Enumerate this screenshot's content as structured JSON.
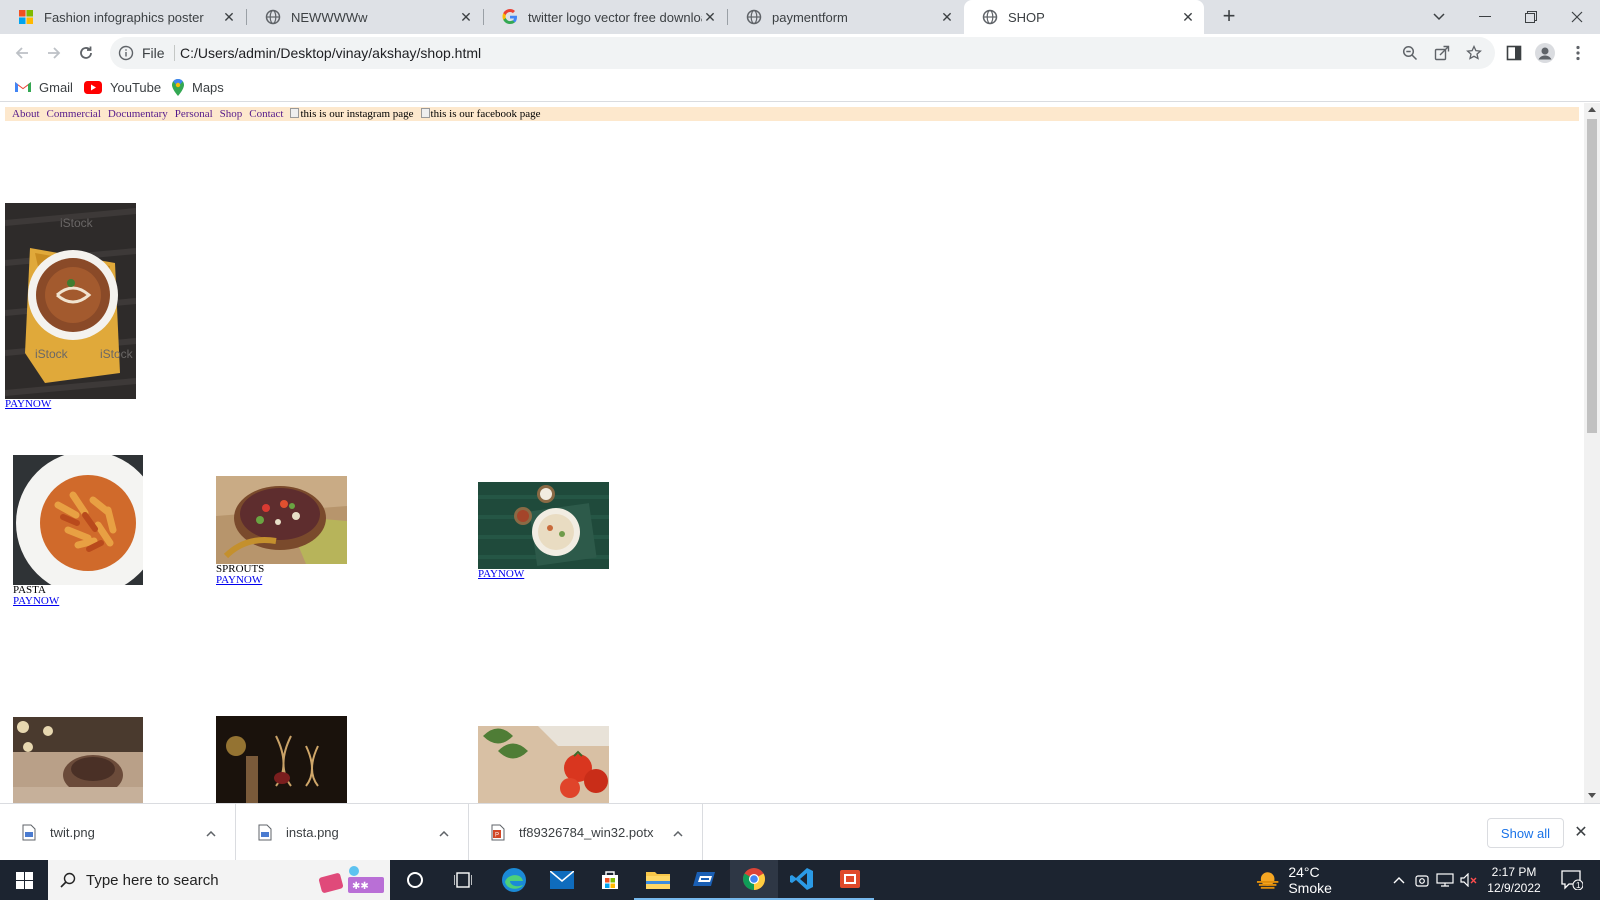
{
  "browser": {
    "tabs": [
      {
        "title": "Fashion infographics poster",
        "icon": "windows-logo-icon",
        "active": false
      },
      {
        "title": "NEWWWWw",
        "icon": "globe-icon",
        "active": false
      },
      {
        "title": "twitter logo vector free downloa",
        "icon": "google-g-icon",
        "active": false
      },
      {
        "title": "paymentform",
        "icon": "globe-icon",
        "active": false
      },
      {
        "title": "SHOP",
        "icon": "globe-icon",
        "active": true
      }
    ],
    "omnibox": {
      "scheme_label": "File",
      "url": "C:/Users/admin/Desktop/vinay/akshay/shop.html"
    },
    "bookmarks": [
      {
        "label": "Gmail",
        "icon": "gmail-icon"
      },
      {
        "label": "YouTube",
        "icon": "youtube-icon"
      },
      {
        "label": "Maps",
        "icon": "maps-pin-icon"
      }
    ]
  },
  "page": {
    "nav": [
      "About",
      "Commercial",
      "Documentary",
      "Personal",
      "Shop",
      "Contact"
    ],
    "broken_images": [
      "this is our instagram page",
      "this is our facebook page"
    ],
    "products": [
      {
        "name": "",
        "link": "PAYNOW",
        "image": "dal-bowl"
      },
      {
        "name": "PASTA",
        "link": "PAYNOW",
        "image": "pasta-plate"
      },
      {
        "name": "SPROUTS",
        "link": "PAYNOW",
        "image": "sprouts-bowl"
      },
      {
        "name": "",
        "link": "PAYNOW",
        "image": "rice-bowls"
      },
      {
        "name": "",
        "link": "",
        "image": "dessert"
      },
      {
        "name": "",
        "link": "",
        "image": "wine-glasses"
      },
      {
        "name": "",
        "link": "",
        "image": "tomatoes"
      }
    ]
  },
  "downloads": {
    "items": [
      {
        "name": "twit.png"
      },
      {
        "name": "insta.png"
      },
      {
        "name": "tf89326784_win32.potx"
      }
    ],
    "show_all": "Show all"
  },
  "taskbar": {
    "search_placeholder": "Type here to search",
    "weather": "24°C  Smoke",
    "time": "2:17 PM",
    "date": "12/9/2022",
    "notification_count": "1"
  }
}
